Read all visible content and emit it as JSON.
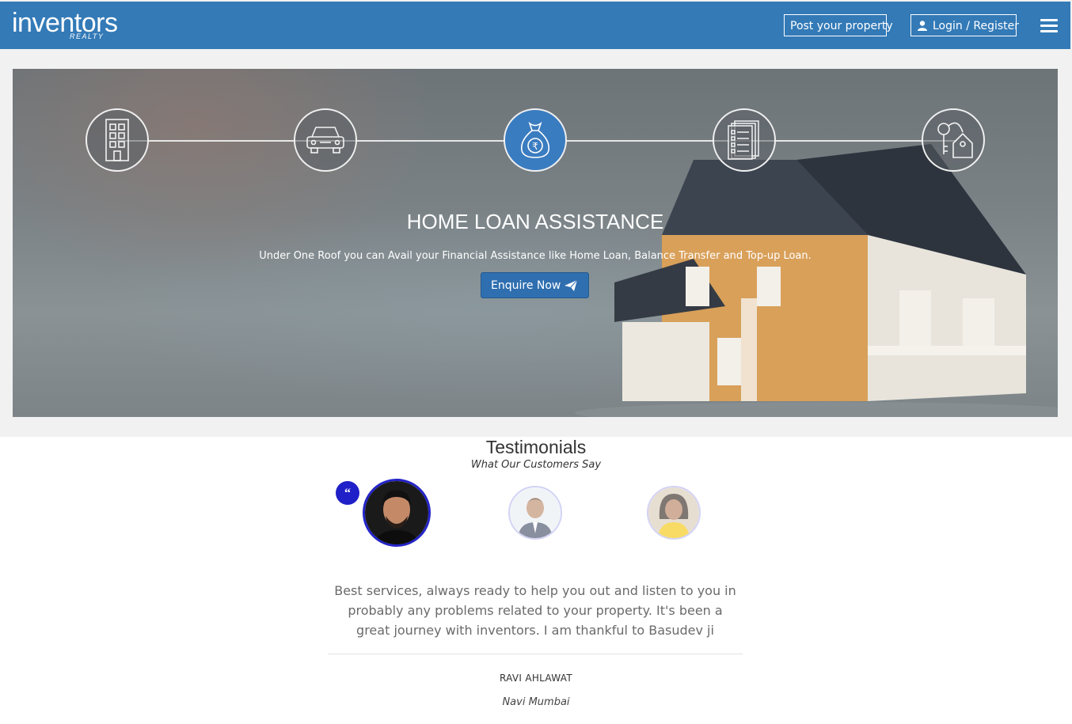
{
  "header": {
    "logo_text": "inventors",
    "logo_subtext": "REALTY",
    "post_property_label": "Post your property",
    "login_label": "Login / Register",
    "brand_color": "#337ab7"
  },
  "hero": {
    "steps": [
      {
        "icon": "building-icon",
        "active": false
      },
      {
        "icon": "car-icon",
        "active": false
      },
      {
        "icon": "money-bag-rupee-icon",
        "active": true
      },
      {
        "icon": "document-list-icon",
        "active": false
      },
      {
        "icon": "key-house-icon",
        "active": false
      }
    ],
    "title": "HOME LOAN ASSISTANCE",
    "subtitle": "Under One Roof you can Avail your Financial Assistance like Home Loan, Balance Transfer and Top-up Loan.",
    "cta_label": "Enquire Now"
  },
  "testimonials": {
    "title": "Testimonials",
    "subtitle": "What Our Customers Say",
    "quote_mark": "“",
    "active_testimonial": {
      "text": "Best services, always ready to help you out and listen to you in probably any problems related to your property. It's been a great journey with inventors. I am thankful to Basudev ji",
      "name": "RAVI AHLAWAT",
      "location": "Navi Mumbai"
    }
  }
}
